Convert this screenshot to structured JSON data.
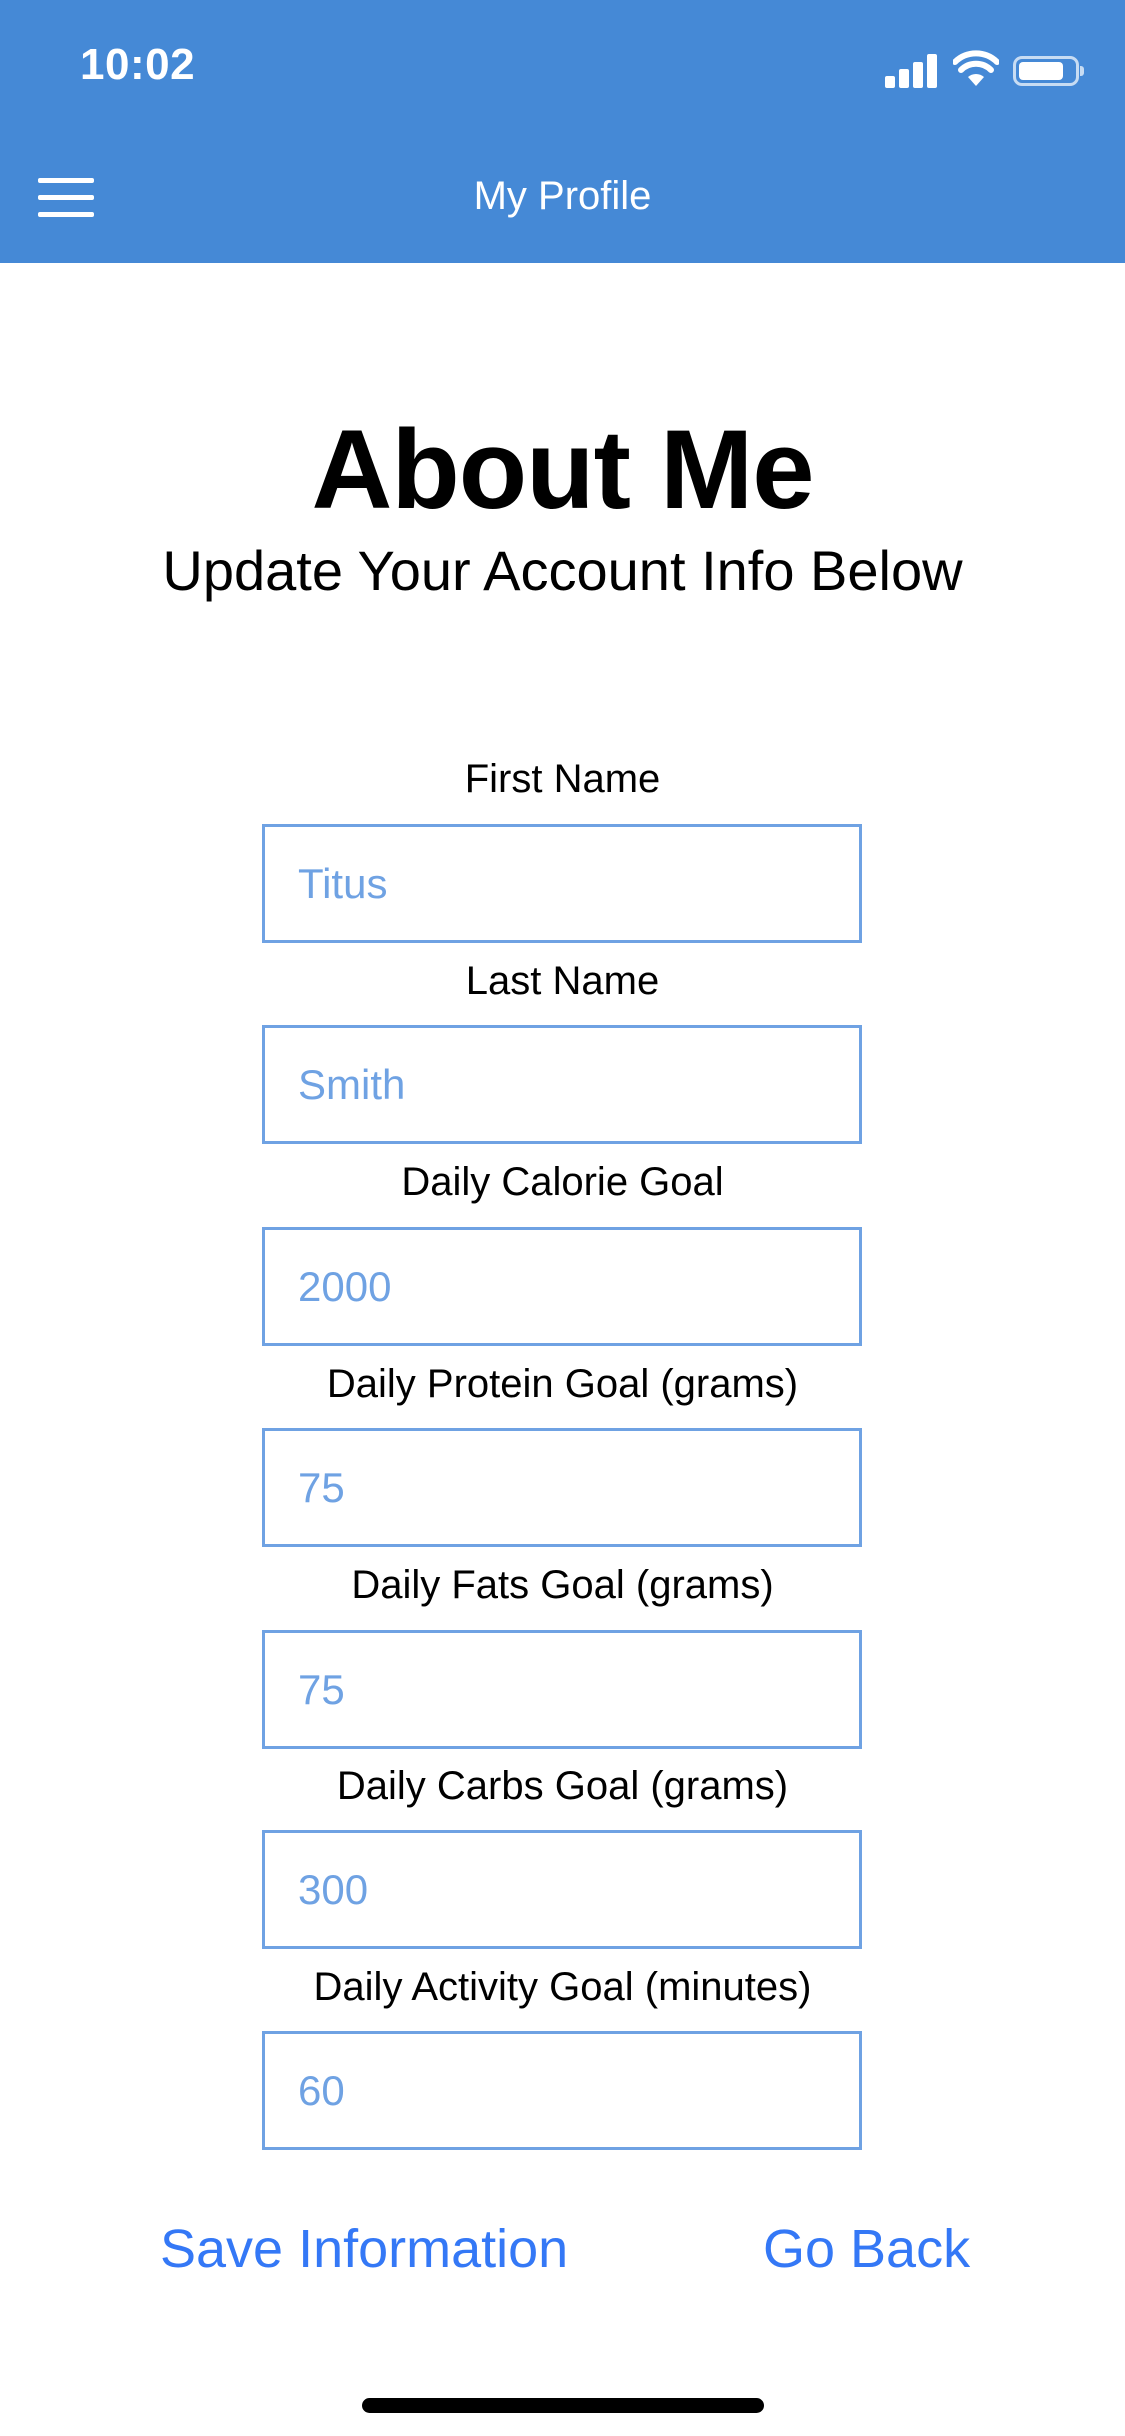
{
  "status_bar": {
    "time": "10:02"
  },
  "nav": {
    "title": "My Profile",
    "menu_icon": "hamburger-menu-icon"
  },
  "header": {
    "title": "About Me",
    "subtitle": "Update Your Account Info Below"
  },
  "form": {
    "fields": [
      {
        "label": "First Name",
        "placeholder": "Titus"
      },
      {
        "label": "Last Name",
        "placeholder": "Smith"
      },
      {
        "label": "Daily Calorie Goal",
        "placeholder": "2000"
      },
      {
        "label": "Daily Protein Goal (grams)",
        "placeholder": "75"
      },
      {
        "label": "Daily Fats Goal (grams)",
        "placeholder": "75"
      },
      {
        "label": "Daily Carbs Goal (grams)",
        "placeholder": "300"
      },
      {
        "label": "Daily Activity Goal (minutes)",
        "placeholder": "60"
      }
    ]
  },
  "actions": {
    "save_label": "Save Information",
    "back_label": "Go Back"
  },
  "colors": {
    "header_bg": "#4589d6",
    "input_border": "#6fa2e3",
    "link": "#3478f6"
  }
}
